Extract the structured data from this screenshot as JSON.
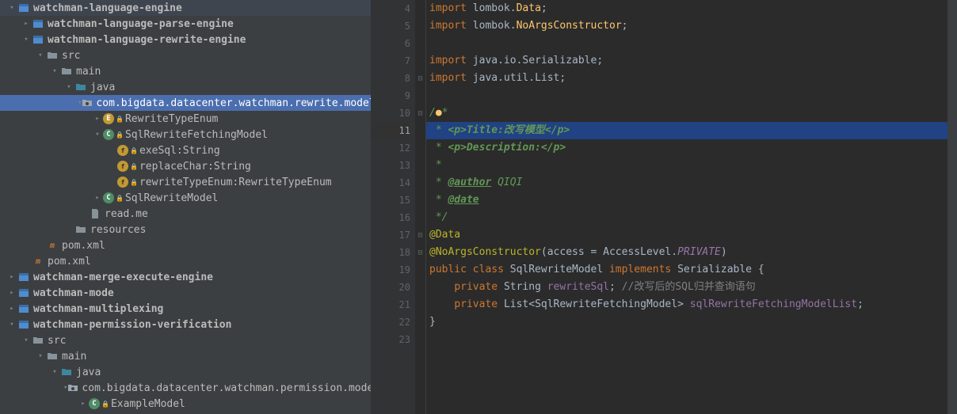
{
  "tree": [
    {
      "indent": 0,
      "chev": "down",
      "icon": "module",
      "label": "watchman-language-engine",
      "bold": true
    },
    {
      "indent": 1,
      "chev": "right",
      "icon": "module",
      "label": "watchman-language-parse-engine",
      "bold": true
    },
    {
      "indent": 1,
      "chev": "down",
      "icon": "module",
      "label": "watchman-language-rewrite-engine",
      "bold": true
    },
    {
      "indent": 2,
      "chev": "down",
      "icon": "folder",
      "label": "src"
    },
    {
      "indent": 3,
      "chev": "down",
      "icon": "folder",
      "label": "main"
    },
    {
      "indent": 4,
      "chev": "down",
      "icon": "folder-src",
      "label": "java"
    },
    {
      "indent": 5,
      "chev": "down",
      "icon": "package",
      "label": "com.bigdata.datacenter.watchman.rewrite.model",
      "selected": true
    },
    {
      "indent": 6,
      "chev": "right",
      "icon": "class-e",
      "label": "RewriteTypeEnum",
      "lock": true
    },
    {
      "indent": 6,
      "chev": "down",
      "icon": "class-c",
      "label": "SqlRewriteFetchingModel",
      "lock": true
    },
    {
      "indent": 7,
      "chev": "",
      "icon": "field",
      "label": "exeSql:String",
      "lock": true
    },
    {
      "indent": 7,
      "chev": "",
      "icon": "field",
      "label": "replaceChar:String",
      "lock": true
    },
    {
      "indent": 7,
      "chev": "",
      "icon": "field",
      "label": "rewriteTypeEnum:RewriteTypeEnum",
      "lock": true
    },
    {
      "indent": 6,
      "chev": "right",
      "icon": "class-c",
      "label": "SqlRewriteModel",
      "lock": true
    },
    {
      "indent": 5,
      "chev": "",
      "icon": "file",
      "label": "read.me"
    },
    {
      "indent": 4,
      "chev": "",
      "icon": "folder",
      "label": "resources"
    },
    {
      "indent": 2,
      "chev": "",
      "icon": "maven",
      "label": "pom.xml"
    },
    {
      "indent": 1,
      "chev": "",
      "icon": "maven",
      "label": "pom.xml"
    },
    {
      "indent": 0,
      "chev": "right",
      "icon": "module",
      "label": "watchman-merge-execute-engine",
      "bold": true
    },
    {
      "indent": 0,
      "chev": "right",
      "icon": "module",
      "label": "watchman-mode",
      "bold": true
    },
    {
      "indent": 0,
      "chev": "right",
      "icon": "module",
      "label": "watchman-multiplexing",
      "bold": true
    },
    {
      "indent": 0,
      "chev": "down",
      "icon": "module",
      "label": "watchman-permission-verification",
      "bold": true
    },
    {
      "indent": 1,
      "chev": "down",
      "icon": "folder",
      "label": "src"
    },
    {
      "indent": 2,
      "chev": "down",
      "icon": "folder",
      "label": "main"
    },
    {
      "indent": 3,
      "chev": "down",
      "icon": "folder-src",
      "label": "java"
    },
    {
      "indent": 4,
      "chev": "down",
      "icon": "package",
      "label": "com.bigdata.datacenter.watchman.permission.model"
    },
    {
      "indent": 5,
      "chev": "right",
      "icon": "class-c",
      "label": "ExampleModel",
      "lock": true
    }
  ],
  "lines": [
    {
      "n": 4,
      "html": "<span class='kw'>import</span> <span class='pkg'>lombok.</span><span class='ident'>Data</span>;"
    },
    {
      "n": 5,
      "html": "<span class='kw'>import</span> <span class='pkg'>lombok.</span><span class='ident'>NoArgsConstructor</span>;"
    },
    {
      "n": 6,
      "html": ""
    },
    {
      "n": 7,
      "html": "<span class='kw'>import</span> <span class='pkg'>java.io.Serializable</span>;"
    },
    {
      "n": 8,
      "html": "<span class='kw'>import</span> <span class='pkg'>java.util.List</span>;"
    },
    {
      "n": 9,
      "html": ""
    },
    {
      "n": 10,
      "html": "<span class='comment'>/</span><span style='color:#ffc66d'>&#9679;</span><span class='comment'>*</span>"
    },
    {
      "n": 11,
      "html": "<span class='comment'> * </span><span class='docbold'>&lt;p&gt;Title:改写模型&lt;/p&gt;</span>",
      "current": true
    },
    {
      "n": 12,
      "html": "<span class='comment'> * </span><span class='docbold'>&lt;p&gt;Description:&lt;/p&gt;</span>"
    },
    {
      "n": 13,
      "html": "<span class='comment'> *</span>"
    },
    {
      "n": 14,
      "html": "<span class='comment'> * </span><span class='doctag'>@author</span><span class='comment'> QIQI</span>"
    },
    {
      "n": 15,
      "html": "<span class='comment'> * </span><span class='doctag'>@date</span>"
    },
    {
      "n": 16,
      "html": "<span class='comment'> */</span>"
    },
    {
      "n": 17,
      "html": "<span class='annotation'>@Data</span>"
    },
    {
      "n": 18,
      "html": "<span class='annotation'>@NoArgsConstructor</span><span class='paren'>(</span><span class='type'>access = AccessLevel</span>.<span class='const'>PRIVATE</span><span class='paren'>)</span>"
    },
    {
      "n": 19,
      "html": "<span class='kw'>public class</span> <span class='type'>SqlRewriteModel</span> <span class='kw'>implements</span> <span class='type'>Serializable</span> {"
    },
    {
      "n": 20,
      "html": "    <span class='kw'>private</span> <span class='type'>String</span> <span class='member'>rewriteSql</span>; <span class='comment-line'>//改写后的SQL归并查询语句</span>"
    },
    {
      "n": 21,
      "html": "    <span class='kw'>private</span> <span class='type'>List&lt;SqlRewriteFetchingModel&gt;</span> <span class='member'>sqlRewriteFetchingModelList</span>;"
    },
    {
      "n": 22,
      "html": "}"
    },
    {
      "n": 23,
      "html": ""
    }
  ],
  "fold": {
    "4": "",
    "5": "",
    "8": "⊟",
    "10": "⊟",
    "17": "⊟",
    "18": "⊟"
  }
}
